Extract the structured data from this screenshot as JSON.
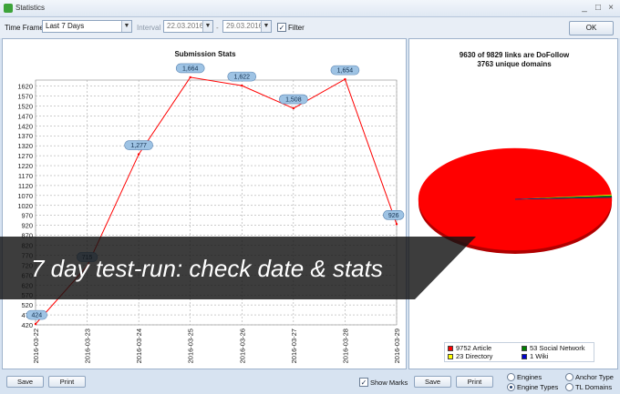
{
  "window": {
    "title": "Statistics",
    "minimize": "_",
    "maximize": "□",
    "close": "×"
  },
  "toolbar": {
    "time_frame_label": "Time Frame",
    "time_frame_value": "Last 7 Days",
    "interval_label": "Interval",
    "date_from": "22.03.2016",
    "date_separator": "-",
    "date_to": "29.03.2016",
    "filter_label": "Filter",
    "filter_checked": "✓",
    "ok_label": "OK"
  },
  "chart_data": {
    "type": "line",
    "title": "Submission Stats",
    "x": [
      "2016-03-22",
      "2016-03-23",
      "2016-03-24",
      "2016-03-25",
      "2016-03-26",
      "2016-03-27",
      "2016-03-28",
      "2016-03-29"
    ],
    "values": [
      424,
      715,
      1277,
      1664,
      1622,
      1508,
      1654,
      926
    ],
    "data_labels": [
      "424",
      "715",
      "1,277",
      "1,664",
      "1,622",
      "1,508",
      "1,654",
      "926"
    ],
    "y_ticks": [
      420,
      470,
      520,
      570,
      620,
      670,
      720,
      770,
      820,
      870,
      920,
      970,
      1020,
      1070,
      1120,
      1170,
      1220,
      1270,
      1320,
      1370,
      1420,
      1470,
      1520,
      1570,
      1620
    ],
    "ylim": [
      420,
      1650
    ],
    "line_color": "#ff0000",
    "grid": true
  },
  "pie": {
    "caption_line1": "9630 of 9829 links are DoFollow",
    "caption_line2": "3763 unique domains",
    "slices": [
      {
        "label": "Article",
        "value": 9752,
        "color": "#ff0000"
      },
      {
        "label": "Directory",
        "value": 23,
        "color": "#ffff00"
      },
      {
        "label": "Social Network",
        "value": 53,
        "color": "#008000"
      },
      {
        "label": "Wiki",
        "value": 1,
        "color": "#0000cc"
      }
    ],
    "legend": [
      {
        "text": "9752 Article",
        "color": "#ff0000"
      },
      {
        "text": "23 Directory",
        "color": "#ffff00"
      },
      {
        "text": "53 Social Network",
        "color": "#008000"
      },
      {
        "text": "1 Wiki",
        "color": "#0000cc"
      }
    ]
  },
  "bottom": {
    "save_label": "Save",
    "print_label": "Print",
    "show_marks_label": "Show Marks",
    "show_marks_checked": "✓",
    "engines_label": "Engines",
    "engine_types_label": "Engine Types",
    "anchor_type_label": "Anchor Type",
    "tl_domains_label": "TL Domains"
  },
  "banner": {
    "text": "7 day test-run: check date & stats"
  }
}
